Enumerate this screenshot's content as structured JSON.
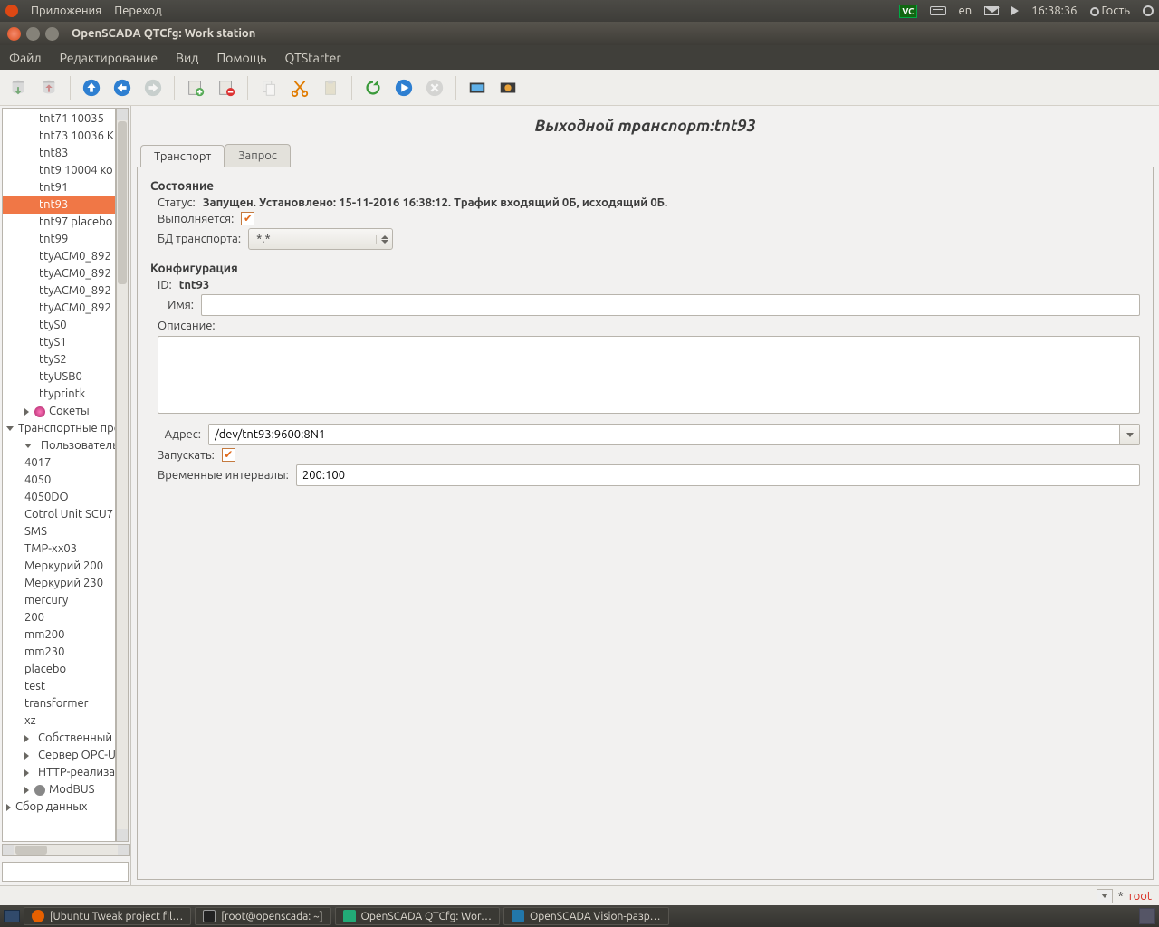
{
  "unity": {
    "apps": "Приложения",
    "goto": "Переход",
    "lang": "en",
    "time": "16:38:36",
    "user": "Гость"
  },
  "window": {
    "title": "OpenSCADA QTCfg: Work station"
  },
  "menu": {
    "file": "Файл",
    "edit": "Редактирование",
    "view": "Вид",
    "help": "Помощь",
    "qtstarter": "QTStarter"
  },
  "tree": {
    "items_top": [
      "tnt71 10035",
      "tnt73 10036 K",
      "tnt83",
      "tnt9 10004 ко",
      "tnt91"
    ],
    "selected": "tnt93",
    "items_aftersel": [
      "tnt97 placebo",
      "tnt99",
      "ttyACM0_892",
      "ttyACM0_892",
      "ttyACM0_892",
      "ttyACM0_892",
      "ttyS0",
      "ttyS1",
      "ttyS2",
      "ttyUSB0",
      "ttyprintk"
    ],
    "sockets": "Сокеты",
    "tproto": "Транспортные прот",
    "userproto": "Пользовательск",
    "userproto_items": [
      "4017",
      "4050",
      "4050DO",
      "Cotrol Unit SCU7",
      "SMS",
      "TMP-xx03",
      "Меркурий 200",
      "Меркурий 230",
      "mercury",
      "200",
      "mm200",
      "mm230",
      "placebo",
      "test",
      "transformer",
      "xz"
    ],
    "ownproto": "Собственный пр",
    "opcua": "Сервер OPC-UA",
    "http": "HTTP-реализаци",
    "modbus": "ModBUS",
    "daq": "Сбор данных"
  },
  "main": {
    "title": "Выходной транспорт:tnt93",
    "tab_transport": "Транспорт",
    "tab_request": "Запрос",
    "state_hdr": "Состояние",
    "status_label": "Статус:",
    "status_value": "Запущен. Установлено: 15-11-2016 16:38:12. Трафик входящий 0Б, исходящий 0Б.",
    "running_label": "Выполняется:",
    "db_label": "БД транспорта:",
    "db_value": "*.*",
    "config_hdr": "Конфигурация",
    "id_label": "ID:",
    "id_value": "tnt93",
    "name_label": "Имя:",
    "name_value": "",
    "desc_label": "Описание:",
    "desc_value": "",
    "addr_label": "Адрес:",
    "addr_value": "/dev/tnt93:9600:8N1",
    "start_label": "Запускать:",
    "timings_label": "Временные интервалы:",
    "timings_value": "200:100"
  },
  "status": {
    "star": "*",
    "root": "root"
  },
  "taskbar": {
    "t1": "[Ubuntu Tweak project fil…",
    "t2": "[root@openscada: ~]",
    "t3": "OpenSCADA QTCfg: Wor…",
    "t4": "OpenSCADA Vision-разр…"
  }
}
